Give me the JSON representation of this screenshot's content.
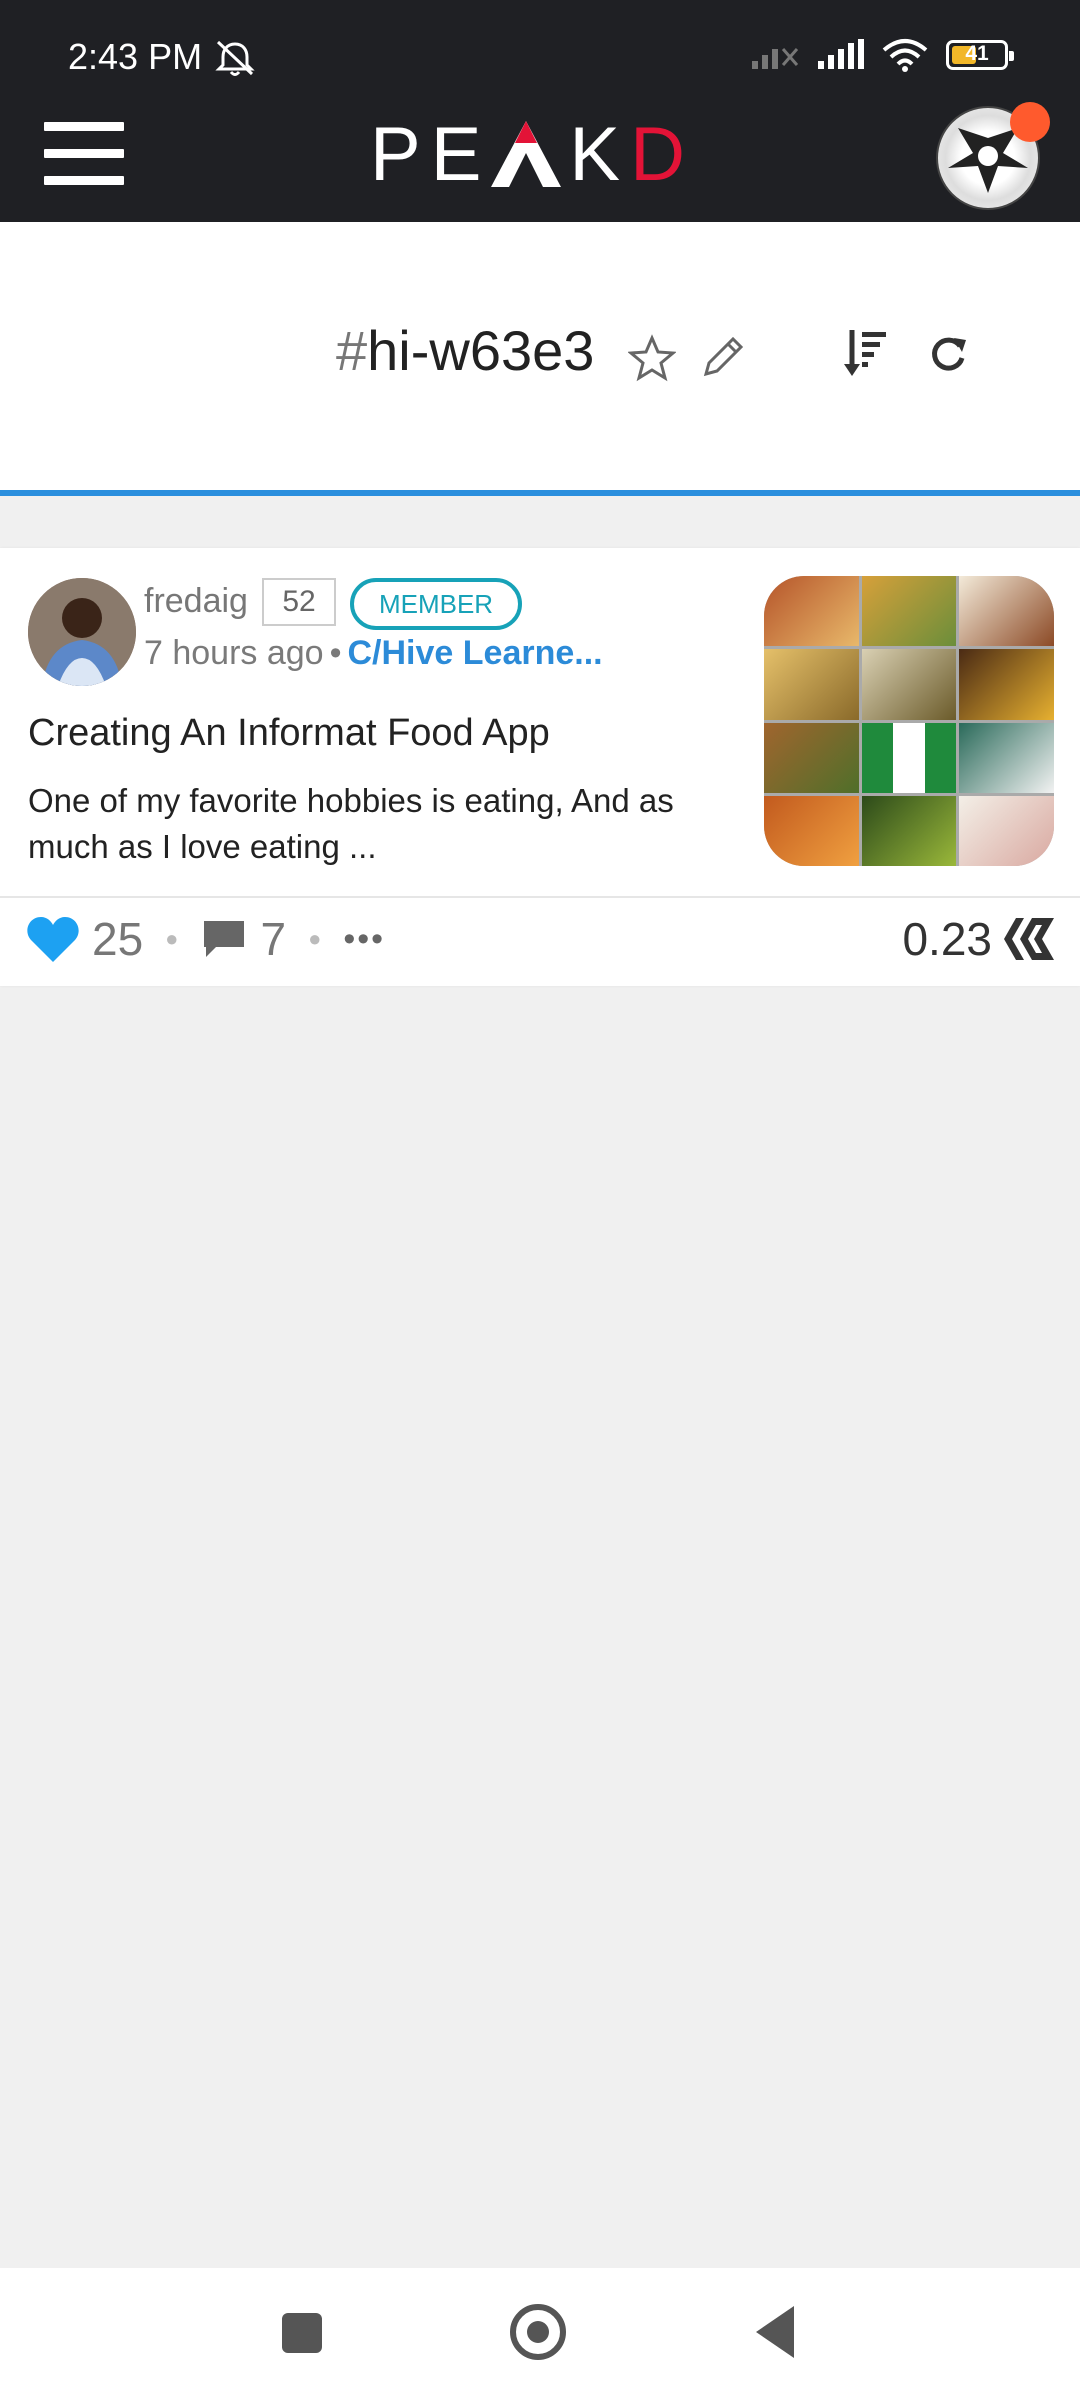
{
  "status_bar": {
    "time": "2:43 PM",
    "battery": "41"
  },
  "header": {
    "logo_prefix": "PE",
    "logo_a": "A",
    "logo_k": "K",
    "logo_d": "D"
  },
  "tag_page": {
    "hash": "#",
    "tag": "hi-w63e3"
  },
  "post": {
    "author": "fredaig",
    "reputation": "52",
    "role_badge": "MEMBER",
    "time_ago": "7 hours ago",
    "separator": "•",
    "community": "C/Hive Learne...",
    "title": "Creating An Informat Food App",
    "excerpt": "One of my favorite hobbies is eating, And as much as I love eating ...",
    "votes": "25",
    "comments": "7",
    "more": "•••",
    "payout": "0.23"
  },
  "colors": {
    "header_bg": "#1f2024",
    "brand_red": "#e31337",
    "accent_blue": "#2b8fde",
    "member_teal": "#17a2b8",
    "heart_blue": "#1da1f2"
  }
}
